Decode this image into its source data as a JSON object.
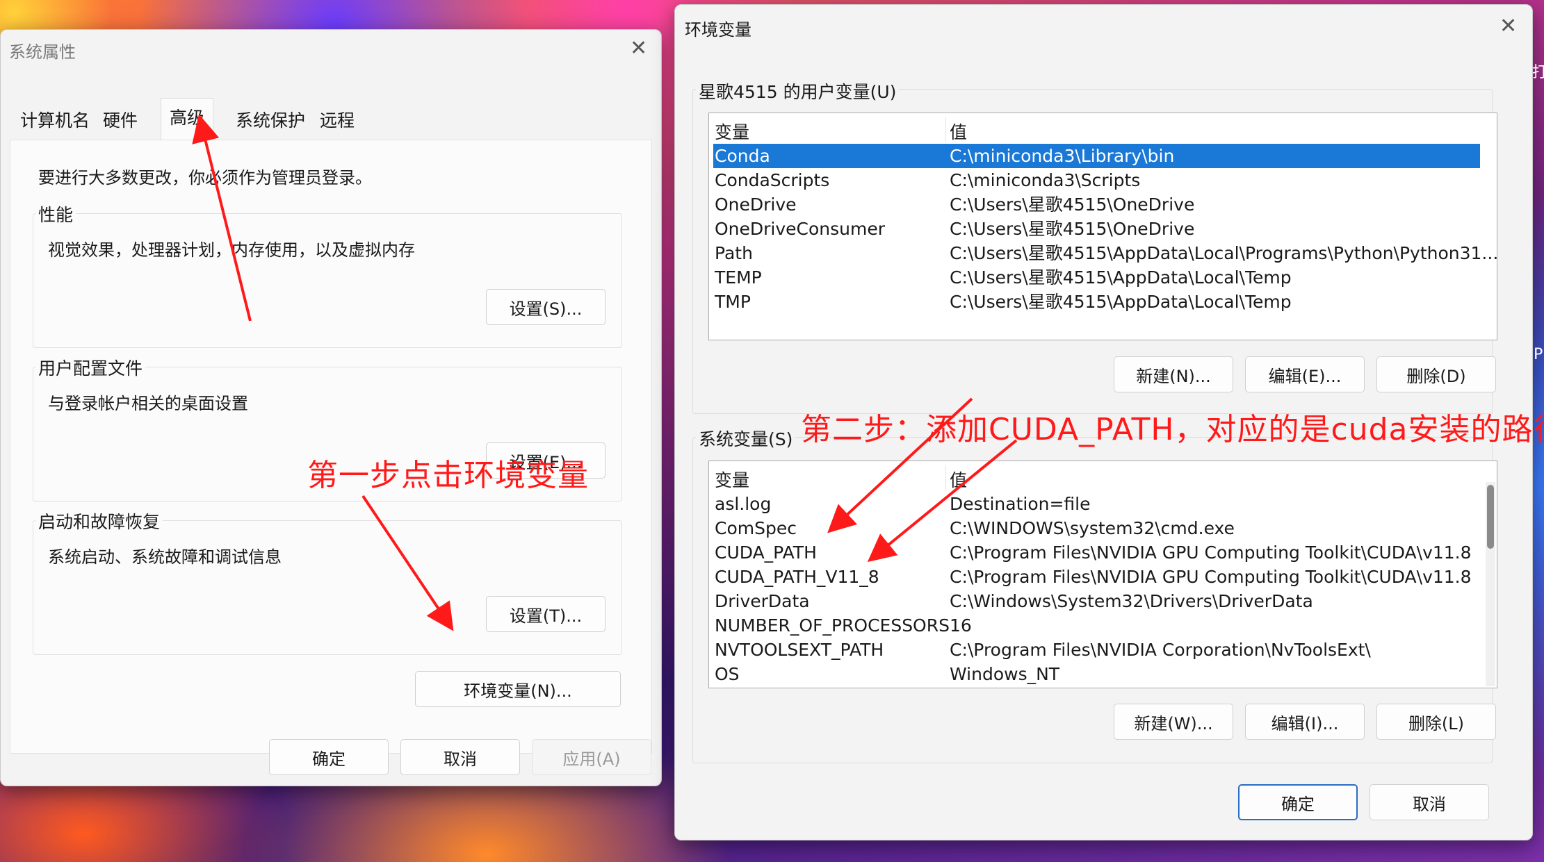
{
  "sys_props": {
    "title": "系统属性",
    "tabs": [
      "计算机名",
      "硬件",
      "高级",
      "系统保护",
      "远程"
    ],
    "admin_note": "要进行大多数更改，你必须作为管理员登录。",
    "performance": {
      "label": "性能",
      "desc": "视觉效果，处理器计划，内存使用，以及虚拟内存",
      "button": "设置(S)..."
    },
    "profile": {
      "label": "用户配置文件",
      "desc": "与登录帐户相关的桌面设置",
      "button": "设置(E)..."
    },
    "startup": {
      "label": "启动和故障恢复",
      "desc": "系统启动、系统故障和调试信息",
      "button": "设置(T)..."
    },
    "env_button": "环境变量(N)...",
    "ok": "确定",
    "cancel": "取消",
    "apply": "应用(A)"
  },
  "env_vars": {
    "title": "环境变量",
    "user_section": "星歌4515 的用户变量(U)",
    "col_var": "变量",
    "col_val": "值",
    "user_rows": [
      {
        "name": "Conda",
        "value": "C:\\miniconda3\\Library\\bin"
      },
      {
        "name": "CondaScripts",
        "value": "C:\\miniconda3\\Scripts"
      },
      {
        "name": "OneDrive",
        "value": "C:\\Users\\星歌4515\\OneDrive"
      },
      {
        "name": "OneDriveConsumer",
        "value": "C:\\Users\\星歌4515\\OneDrive"
      },
      {
        "name": "Path",
        "value": "C:\\Users\\星歌4515\\AppData\\Local\\Programs\\Python\\Python31..."
      },
      {
        "name": "TEMP",
        "value": "C:\\Users\\星歌4515\\AppData\\Local\\Temp"
      },
      {
        "name": "TMP",
        "value": "C:\\Users\\星歌4515\\AppData\\Local\\Temp"
      }
    ],
    "user_buttons": {
      "new": "新建(N)...",
      "edit": "编辑(E)...",
      "delete": "删除(D)"
    },
    "system_section": "系统变量(S)",
    "system_rows": [
      {
        "name": "asl.log",
        "value": "Destination=file"
      },
      {
        "name": "ComSpec",
        "value": "C:\\WINDOWS\\system32\\cmd.exe"
      },
      {
        "name": "CUDA_PATH",
        "value": "C:\\Program Files\\NVIDIA GPU Computing Toolkit\\CUDA\\v11.8"
      },
      {
        "name": "CUDA_PATH_V11_8",
        "value": "C:\\Program Files\\NVIDIA GPU Computing Toolkit\\CUDA\\v11.8"
      },
      {
        "name": "DriverData",
        "value": "C:\\Windows\\System32\\Drivers\\DriverData"
      },
      {
        "name": "NUMBER_OF_PROCESSORS",
        "value": "16"
      },
      {
        "name": "NVTOOLSEXT_PATH",
        "value": "C:\\Program Files\\NVIDIA Corporation\\NvToolsExt\\"
      },
      {
        "name": "OS",
        "value": "Windows_NT"
      }
    ],
    "system_buttons": {
      "new": "新建(W)...",
      "edit": "编辑(I)...",
      "delete": "删除(L)"
    },
    "ok": "确定",
    "cancel": "取消"
  },
  "annotations": {
    "step1": "第一步点击环境变量",
    "step2": "第二步：添加CUDA_PATH，对应的是cuda安装的路径"
  },
  "colors": {
    "selection": "#1a78d6",
    "annotation": "#ff1a1a",
    "primary_border": "#2b6cc4"
  }
}
